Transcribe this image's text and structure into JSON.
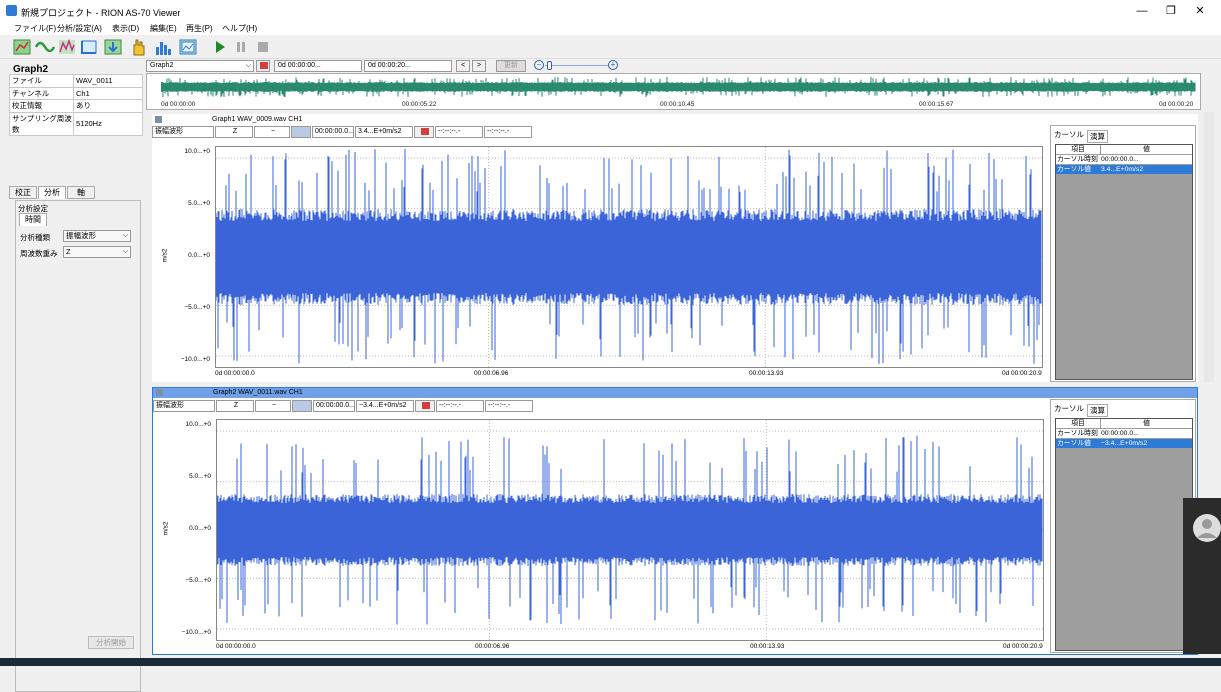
{
  "app": {
    "title": "新規プロジェクト - RION AS-70 Viewer",
    "window_buttons": [
      "—",
      "❐",
      "✕"
    ]
  },
  "menu": [
    "ファイル(F)",
    "分析/設定(A)",
    "表示(D)",
    "編集(E)",
    "再生(P)",
    "ヘルプ(H)"
  ],
  "toolbar_icons": [
    "new-graph-icon",
    "wave-icon",
    "spectrum-icon",
    "axis-icon",
    "export-icon",
    "cursor-hand-icon",
    "histogram-icon",
    "image-icon",
    "play-icon",
    "pause-icon",
    "stop-icon"
  ],
  "left": {
    "title": "Graph2",
    "props": [
      {
        "k": "ファイル",
        "v": "WAV_0011"
      },
      {
        "k": "チャンネル",
        "v": "Ch1"
      },
      {
        "k": "校正情報",
        "v": "あり"
      },
      {
        "k": "サンプリング周波数",
        "v": "5120Hz"
      }
    ],
    "tabs": [
      "校正",
      "分析",
      "軸"
    ],
    "section_title": "分析設定",
    "subtab": "時間",
    "fields": [
      {
        "label": "分析種類",
        "value": "振幅波形"
      },
      {
        "label": "周波数重み",
        "value": "Z"
      }
    ],
    "analyze_button": "分析開始"
  },
  "global": {
    "graph_select": "Graph2",
    "start_time": "0d 00:00:00...",
    "end_time": "0d 00:00:20...",
    "prev": "<",
    "next": ">",
    "update": "更新",
    "zoom_out": "−",
    "zoom_in": "+"
  },
  "overview": {
    "ticks": [
      "0d 00:00:00",
      "00:00:05.22",
      "00:00:10.45",
      "00:00:15.67",
      "0d 00:00:20"
    ],
    "wave_color": "#2a8a6e"
  },
  "graphs": [
    {
      "title": "Graph1 WAV_0009.wav CH1",
      "analysis": "振幅波形",
      "weight": "Z",
      "dash": "−",
      "time": "00:00:00.0...",
      "value": "3.4...E+0m/s2",
      "dashes1": "--:--:--.-",
      "dashes2": "--:--:--.-",
      "yticks": [
        "10.0...+0",
        "5.0...+0",
        "0.0...+0",
        "−5.0...+0",
        "−10.0...+0"
      ],
      "unit": "m/s2",
      "xticks": [
        "0d 00:00:00.0",
        "00:00:06.96",
        "00:00:13.93",
        "0d 00:00:20.9"
      ],
      "cursor_tabs": [
        "カーソル",
        "演算"
      ],
      "cursor_head": [
        "項目",
        "値"
      ],
      "cursor_rows": [
        {
          "k": "カーソル時刻",
          "v": "00:00:00.0..."
        },
        {
          "k": "カーソル値",
          "v": "3.4...E+0m/s2"
        }
      ],
      "wave_color": "#3a64d8"
    },
    {
      "title": "Graph2 WAV_0011.wav CH1",
      "analysis": "振幅波形",
      "weight": "Z",
      "dash": "−",
      "time": "00:00:00.0...",
      "value": "−3.4...E+0m/s2",
      "dashes1": "--:--:--.-",
      "dashes2": "--:--:--.-",
      "yticks": [
        "10.0...+0",
        "5.0...+0",
        "0.0...+0",
        "−5.0...+0",
        "−10.0...+0"
      ],
      "unit": "m/s2",
      "xticks": [
        "0d 00:00:00.0",
        "00:00:06.96",
        "00:00:13.93",
        "0d 00:00:20.9"
      ],
      "cursor_tabs": [
        "カーソル",
        "演算"
      ],
      "cursor_head": [
        "項目",
        "値"
      ],
      "cursor_rows": [
        {
          "k": "カーソル時刻",
          "v": "00:00:00.0..."
        },
        {
          "k": "カーソル値",
          "v": "−3.4...E+0m/s2"
        }
      ],
      "wave_color": "#3a64d8"
    }
  ]
}
